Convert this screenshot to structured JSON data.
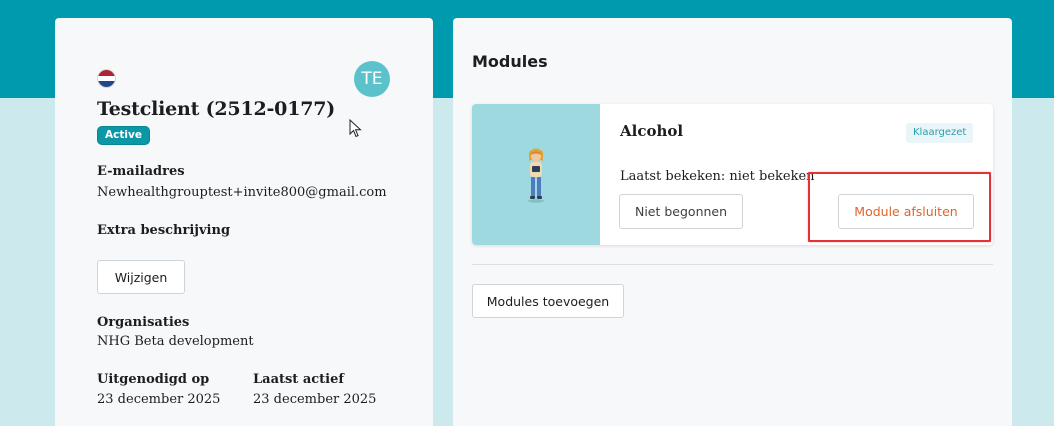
{
  "colors": {
    "teal": "#009aaf",
    "background": "#cce9ee",
    "card": "#f7f8fa",
    "accent_orange": "#e0642b",
    "highlight_red": "#e03333"
  },
  "client": {
    "flag_icon": "netherlands-flag-icon",
    "avatar_initials": "TE",
    "name": "Testclient (2512-0177)",
    "status": "Active",
    "email_label": "E-mailadres",
    "email": "Newhealthgrouptest+invite800@gmail.com",
    "extra_description_label": "Extra beschrijving",
    "edit_button": "Wijzigen",
    "organisations_label": "Organisaties",
    "organisation": "NHG Beta development",
    "invited_label": "Uitgenodigd op",
    "invited_date": "23 december 2025",
    "last_active_label": "Laatst actief",
    "last_active_date": "23 december 2025"
  },
  "modules": {
    "title": "Modules",
    "items": [
      {
        "name": "Alcohol",
        "badge": "Klaargezet",
        "last_viewed": "Laatst bekeken: niet bekeken",
        "status_button": "Niet begonnen",
        "close_button": "Module afsluiten",
        "image_icon": "person-illustration-icon"
      }
    ],
    "add_button": "Modules toevoegen"
  }
}
